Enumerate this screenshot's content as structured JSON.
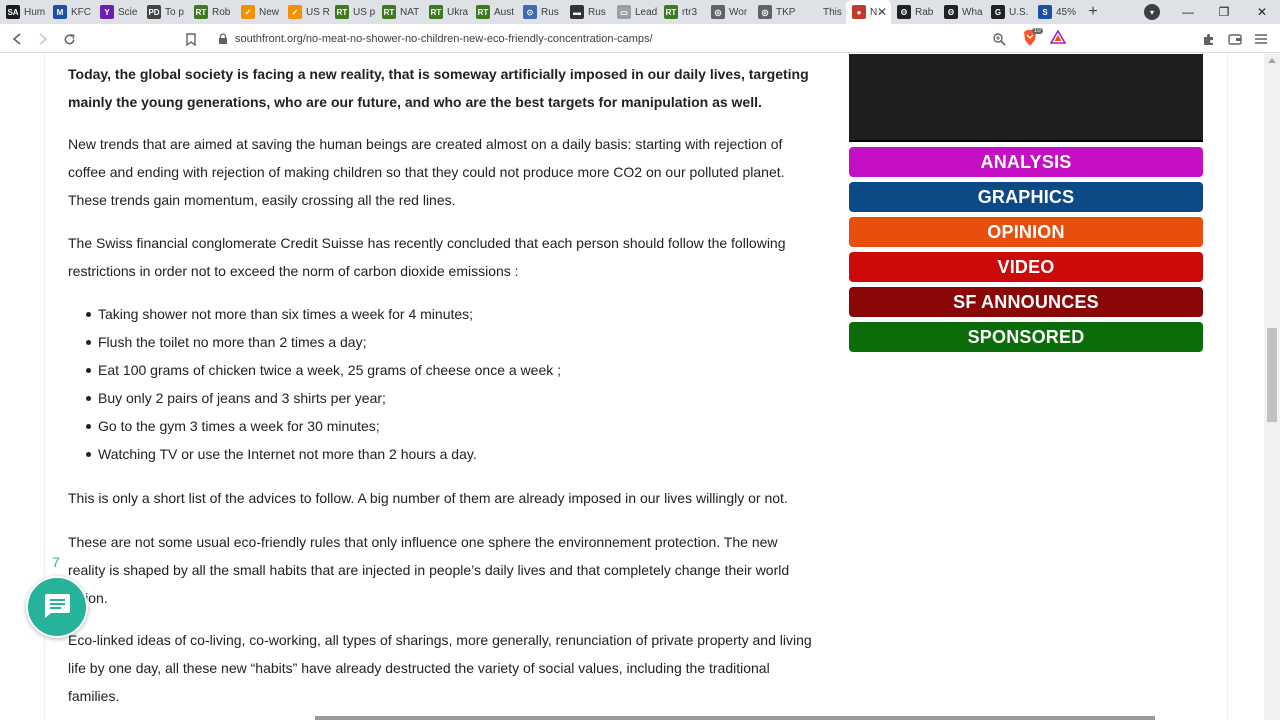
{
  "browser": {
    "tabs": [
      {
        "title": "Hum",
        "fav": "SA",
        "fav_color": "#1a1a1a"
      },
      {
        "title": "KFC",
        "fav": "M",
        "fav_color": "#1e4fa8"
      },
      {
        "title": "Scie",
        "fav": "Y",
        "fav_color": "#6b1fb0"
      },
      {
        "title": "To p",
        "fav": "PD",
        "fav_color": "#444444"
      },
      {
        "title": "Rob",
        "fav": "RT",
        "fav_color": "#3d7a1f"
      },
      {
        "title": "New",
        "fav": "✓",
        "fav_color": "#f29200"
      },
      {
        "title": "US R",
        "fav": "✓",
        "fav_color": "#f29200"
      },
      {
        "title": "US p",
        "fav": "RT",
        "fav_color": "#3d7a1f"
      },
      {
        "title": "NAT",
        "fav": "RT",
        "fav_color": "#3d7a1f"
      },
      {
        "title": "Ukra",
        "fav": "RT",
        "fav_color": "#3d7a1f"
      },
      {
        "title": "Aust",
        "fav": "RT",
        "fav_color": "#3d7a1f"
      },
      {
        "title": "Rus",
        "fav": "⊙",
        "fav_color": "#3f6ab5"
      },
      {
        "title": "Rus",
        "fav": "▬",
        "fav_color": "#333333"
      },
      {
        "title": "Lead",
        "fav": "▭",
        "fav_color": "#9aa0a6"
      },
      {
        "title": "rtr3",
        "fav": "RT",
        "fav_color": "#3d7a1f"
      },
      {
        "title": "Wor",
        "fav": "◎",
        "fav_color": "#5f6368"
      },
      {
        "title": "TKP",
        "fav": "◎",
        "fav_color": "#5f6368"
      },
      {
        "title": "This",
        "fav": "",
        "fav_color": "#dee1e6"
      },
      {
        "title": "N",
        "fav": "●",
        "fav_color": "#c0392b",
        "active": true
      },
      {
        "title": "Rab",
        "fav": "Θ",
        "fav_color": "#202124"
      },
      {
        "title": "Wha",
        "fav": "Θ",
        "fav_color": "#202124"
      },
      {
        "title": "U.S.",
        "fav": "G",
        "fav_color": "#202124"
      },
      {
        "title": "45%",
        "fav": "S",
        "fav_color": "#1c4fa0"
      }
    ],
    "new_tab_label": "+",
    "tab_close": "✕",
    "url": "southfront.org/no-meat-no-shower-no-children-new-eco-friendly-concentration-camps/",
    "brave_badge": "10"
  },
  "article": {
    "intro": "Today, the global society is facing a new reality, that is someway artificially imposed in our daily lives, targeting mainly the young generations, who are our future, and who are the best targets for manipulation as well.",
    "p1": "New trends that are aimed at saving the human beings are created almost on a daily basis: starting with rejection of coffee and ending with rejection of making children so that they could not produce more CO2 on our polluted planet. These trends gain momentum, easily crossing all the red lines.",
    "p2": "The Swiss financial conglomerate Credit Suisse has recently concluded that each person should follow the following restrictions in order not to exceed the norm of carbon dioxide emissions :",
    "bullets": [
      "Taking shower not more than six times a week for 4 minutes;",
      "Flush the toilet no more than 2 times a day;",
      "Eat 100 grams of chicken twice a week, 25 grams of cheese once a week ;",
      "Buy only 2 pairs of jeans and 3 shirts per year;",
      "Go to the gym 3 times a week for 30 minutes;",
      "Watching TV or use the Internet not more than 2 hours a day."
    ],
    "p3": "This is only a short list of the advices to follow. A big number of them are already imposed in our lives willingly or not.",
    "p4": "These are not some usual eco-friendly rules that only influence one sphere the environnement protection. The new reality is shaped by all the small habits that are injected in people’s daily lives and that completely change their world vision.",
    "p5": "Eco-linked ideas of co-living, co-working, all types of sharings, more generally, renunciation of private property and living life by one day, all these new “habits” have already destructed the variety of social values, including the traditional families."
  },
  "sidebar": {
    "categories": [
      {
        "label": "ANALYSIS",
        "color": "#c40fc4"
      },
      {
        "label": "GRAPHICS",
        "color": "#0c4a87"
      },
      {
        "label": "OPINION",
        "color": "#e84f0c"
      },
      {
        "label": "VIDEO",
        "color": "#cc0a0a"
      },
      {
        "label": "SF ANNOUNCES",
        "color": "#8a0707"
      },
      {
        "label": "SPONSORED",
        "color": "#0a6d0a"
      }
    ]
  },
  "chat": {
    "count": "7"
  }
}
